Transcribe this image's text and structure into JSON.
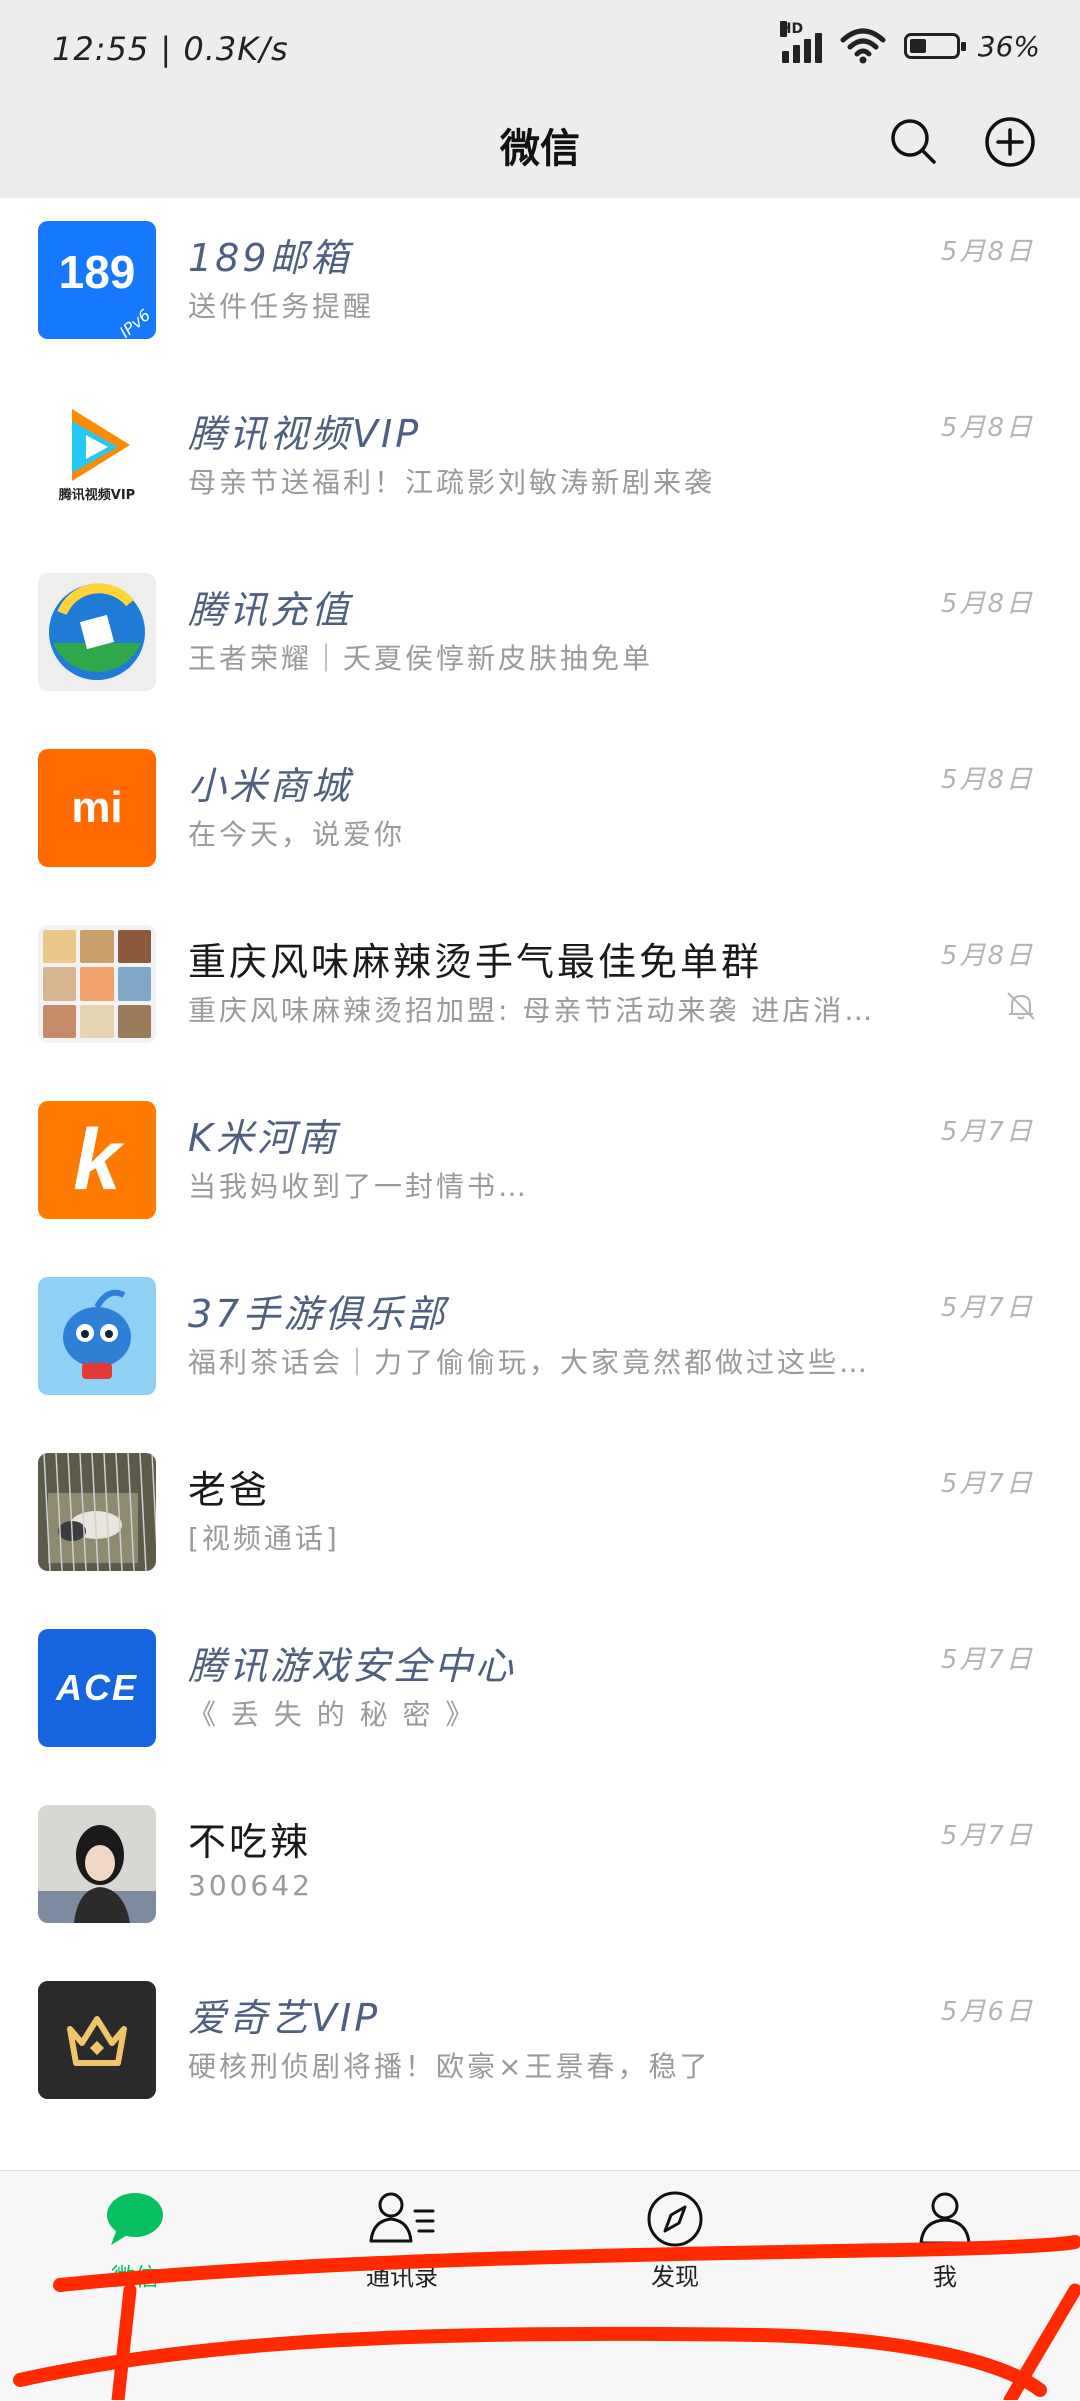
{
  "status_bar": {
    "time": "12:55",
    "speed": "0.3K/s",
    "battery": "36%",
    "network_badge": "HD",
    "battery_level": 0.36
  },
  "header": {
    "title": "微信",
    "search_icon": "search-icon",
    "add_icon": "plus-circle-icon"
  },
  "chats": [
    {
      "name": "189邮箱",
      "preview": "送件任务提醒",
      "time": "5月8日",
      "official": true,
      "avatar": {
        "type": "189",
        "text": "189",
        "sub": "IPv6",
        "bg": "#1677ff"
      }
    },
    {
      "name": "腾讯视频VIP",
      "preview": "母亲节送福利！江疏影刘敏涛新剧来袭",
      "time": "5月8日",
      "official": true,
      "avatar": {
        "type": "tencent-video",
        "sub": "腾讯视频VIP"
      }
    },
    {
      "name": "腾讯充值",
      "preview": "王者荣耀｜夭夏侯惇新皮肤抽免单",
      "time": "5月8日",
      "official": true,
      "avatar": {
        "type": "tencent-recharge"
      }
    },
    {
      "name": "小米商城",
      "preview": "在今天，说爱你",
      "time": "5月8日",
      "official": true,
      "avatar": {
        "type": "xiaomi",
        "text": "mi",
        "bg": "#ff6900"
      }
    },
    {
      "name": "重庆风味麻辣烫手气最佳免单群",
      "preview": "重庆风味麻辣烫招加盟: 母亲节活动来袭 进店消…",
      "time": "5月8日",
      "official": false,
      "muted": true,
      "avatar": {
        "type": "group"
      }
    },
    {
      "name": "K米河南",
      "preview": "当我妈收到了一封情书…",
      "time": "5月7日",
      "official": true,
      "avatar": {
        "type": "kmi",
        "text": "k",
        "bg": "#ff7a00"
      }
    },
    {
      "name": "37手游俱乐部",
      "preview": "福利茶话会｜力了偷偷玩，大家竟然都做过这些…",
      "time": "5月7日",
      "official": true,
      "avatar": {
        "type": "37",
        "bg": "#8fd0f5"
      }
    },
    {
      "name": "老爸",
      "preview": "[视频通话]",
      "time": "5月7日",
      "official": false,
      "avatar": {
        "type": "photo-cage"
      }
    },
    {
      "name": "腾讯游戏安全中心",
      "preview": "《 丢 失 的 秘 密 》",
      "time": "5月7日",
      "official": true,
      "avatar": {
        "type": "ace",
        "text": "ACE",
        "bg": "#1565e0"
      }
    },
    {
      "name": "不吃辣",
      "preview": "300642",
      "time": "5月7日",
      "official": false,
      "avatar": {
        "type": "photo-person"
      }
    },
    {
      "name": "爱奇艺VIP",
      "preview": "硬核刑侦剧将播！欧豪×王景春，稳了",
      "time": "5月6日",
      "official": true,
      "avatar": {
        "type": "iqiyi-vip",
        "bg": "#2a2a2a"
      }
    }
  ],
  "tabs": [
    {
      "label": "微信",
      "icon": "chat-bubble-icon",
      "active": true
    },
    {
      "label": "通讯录",
      "icon": "contacts-icon",
      "active": false
    },
    {
      "label": "发现",
      "icon": "compass-icon",
      "active": false
    },
    {
      "label": "我",
      "icon": "person-icon",
      "active": false
    }
  ],
  "colors": {
    "accent": "#07c160",
    "header_bg": "#ededed",
    "official_name": "#4f5f7f",
    "scribble": "#ff2a00"
  }
}
